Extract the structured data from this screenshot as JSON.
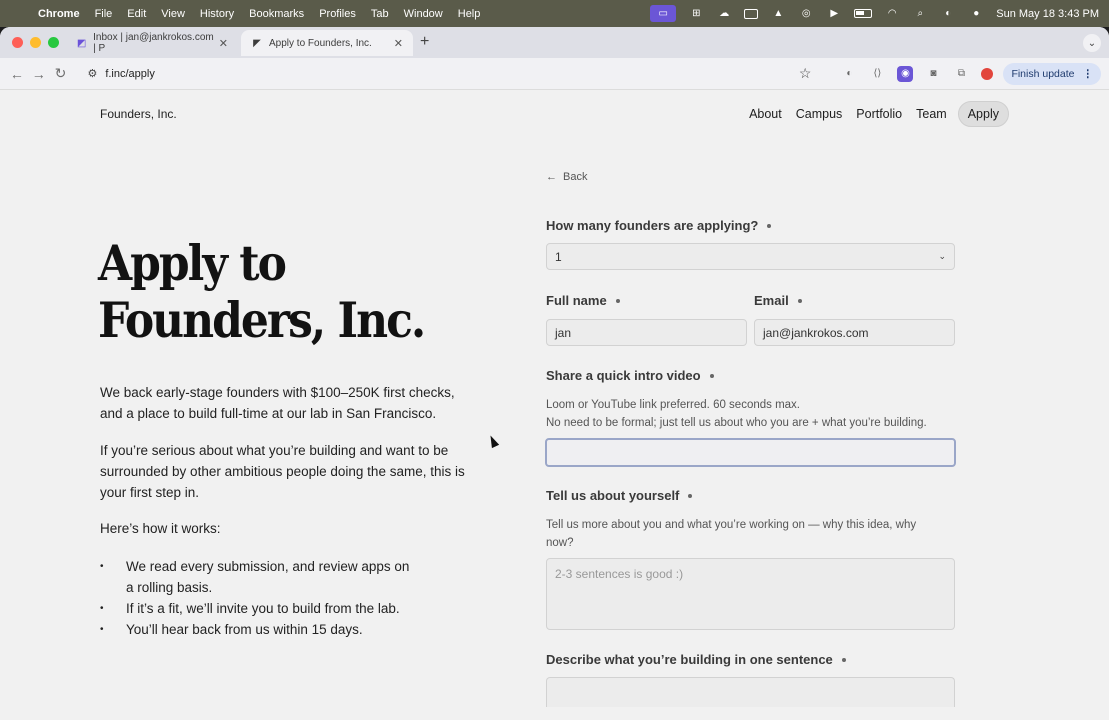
{
  "menubar": {
    "app": "Chrome",
    "items": [
      "File",
      "Edit",
      "View",
      "History",
      "Bookmarks",
      "Profiles",
      "Tab",
      "Window",
      "Help"
    ],
    "clock": "Sun May 18  3:43 PM"
  },
  "browser": {
    "tabs": [
      {
        "title": "Inbox | jan@jankrokos.com | P",
        "icon": "mail-icon"
      },
      {
        "title": "Apply to Founders, Inc.",
        "icon": "founders-logo-icon"
      }
    ],
    "url": "f.inc/apply",
    "finish_update": "Finish update"
  },
  "site": {
    "brand": "Founders, Inc.",
    "nav": [
      "About",
      "Campus",
      "Portfolio",
      "Team",
      "Apply"
    ]
  },
  "hero": {
    "title_line1": "Apply to",
    "title_line2": "Founders, Inc.",
    "lead": "We back early-stage founders with $100–250K first checks, and a place to build full-time at our lab in San Francisco.",
    "lead2": "If you’re serious about what you’re building and want to be surrounded by  other ambitious people doing the same, this is your first step in.",
    "how_title": "Here’s how it works:",
    "steps": [
      "We read every submission, and review apps on a rolling basis.",
      "If it’s a fit, we’ll invite you to build from the lab.",
      "You’ll hear back from us within 15 days."
    ]
  },
  "form": {
    "back": "Back",
    "founders_label": "How many founders are applying?",
    "founders_value": "1",
    "fullname_label": "Full name",
    "fullname_value": "jan",
    "email_label": "Email",
    "email_value": "jan@jankrokos.com",
    "video_label": "Share a quick intro video",
    "video_help1": "Loom or YouTube link preferred. 60 seconds max.",
    "video_help2": "No need to be formal; just tell us about who you are + what you’re building.",
    "video_value": "",
    "about_label": "Tell us about yourself",
    "about_help": "Tell us more about you and what you’re working on — why this idea, why now?",
    "about_placeholder": "2-3 sentences is good :)",
    "oneliner_label": "Describe what you’re building in one sentence"
  }
}
